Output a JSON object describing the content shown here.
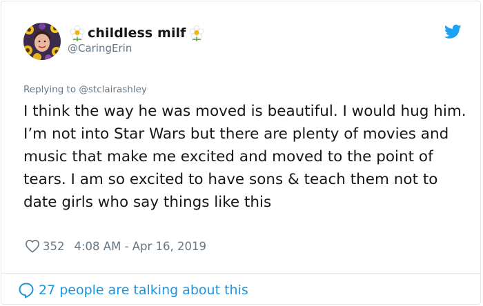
{
  "user": {
    "display_name": "childless milf",
    "handle": "@CaringErin",
    "avatar_icon": "profile-photo-sunflowers",
    "name_emoji_left": "flower-icon",
    "name_emoji_right": "flower-icon"
  },
  "reply": {
    "label": "Replying to @stclairashley"
  },
  "tweet": {
    "text": "I think the way he was moved is beautiful. I would hug him. I’m not into Star Wars but there are plenty of movies and music that make me excited and moved to the point of tears. I am so excited to have sons & teach them not to date girls who say things like this"
  },
  "meta": {
    "likes": "352",
    "timestamp": "4:08 AM - Apr 16, 2019"
  },
  "footer": {
    "label": "27 people are talking about this"
  },
  "colors": {
    "brand": "#1da1f2",
    "link": "#1b95e0",
    "muted": "#657786",
    "text": "#14171a",
    "border": "#e1e8ed"
  }
}
